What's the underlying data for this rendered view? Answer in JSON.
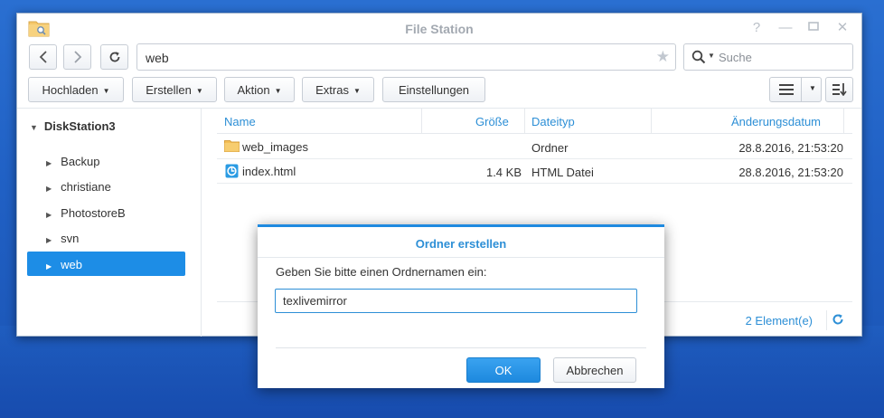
{
  "window": {
    "title": "File Station",
    "icons": {
      "app": "folder-search-icon",
      "help": "help-icon",
      "minimize": "minimize-icon",
      "maximize": "maximize-icon",
      "close": "close-icon"
    }
  },
  "toolbar": {
    "path": "web",
    "search_placeholder": "Suche",
    "buttons": {
      "upload": "Hochladen",
      "create": "Erstellen",
      "action": "Aktion",
      "extras": "Extras",
      "settings": "Einstellungen"
    }
  },
  "sidebar": {
    "root": "DiskStation3",
    "items": [
      {
        "label": "Backup"
      },
      {
        "label": "christiane"
      },
      {
        "label": "PhotostoreB"
      },
      {
        "label": "svn"
      },
      {
        "label": "web"
      }
    ],
    "selected": "web"
  },
  "list": {
    "columns": [
      "Name",
      "Größe",
      "Dateityp",
      "Änderungsdatum"
    ],
    "rows": [
      {
        "name": "web_images",
        "size": "",
        "type": "Ordner",
        "modified": "28.8.2016, 21:53:20",
        "icon": "folder-icon"
      },
      {
        "name": "index.html",
        "size": "1.4 KB",
        "type": "HTML Datei",
        "modified": "28.8.2016, 21:53:20",
        "icon": "html-file-icon"
      }
    ],
    "count": "2 Element(e)"
  },
  "dialog": {
    "title": "Ordner erstellen",
    "prompt": "Geben Sie bitte einen Ordnernamen ein:",
    "input_value": "texlivemirror",
    "ok": "OK",
    "cancel": "Abbrechen"
  },
  "colors": {
    "accent": "#1d8de6",
    "link": "#2d8fd6",
    "desktop": "#2062c6"
  }
}
